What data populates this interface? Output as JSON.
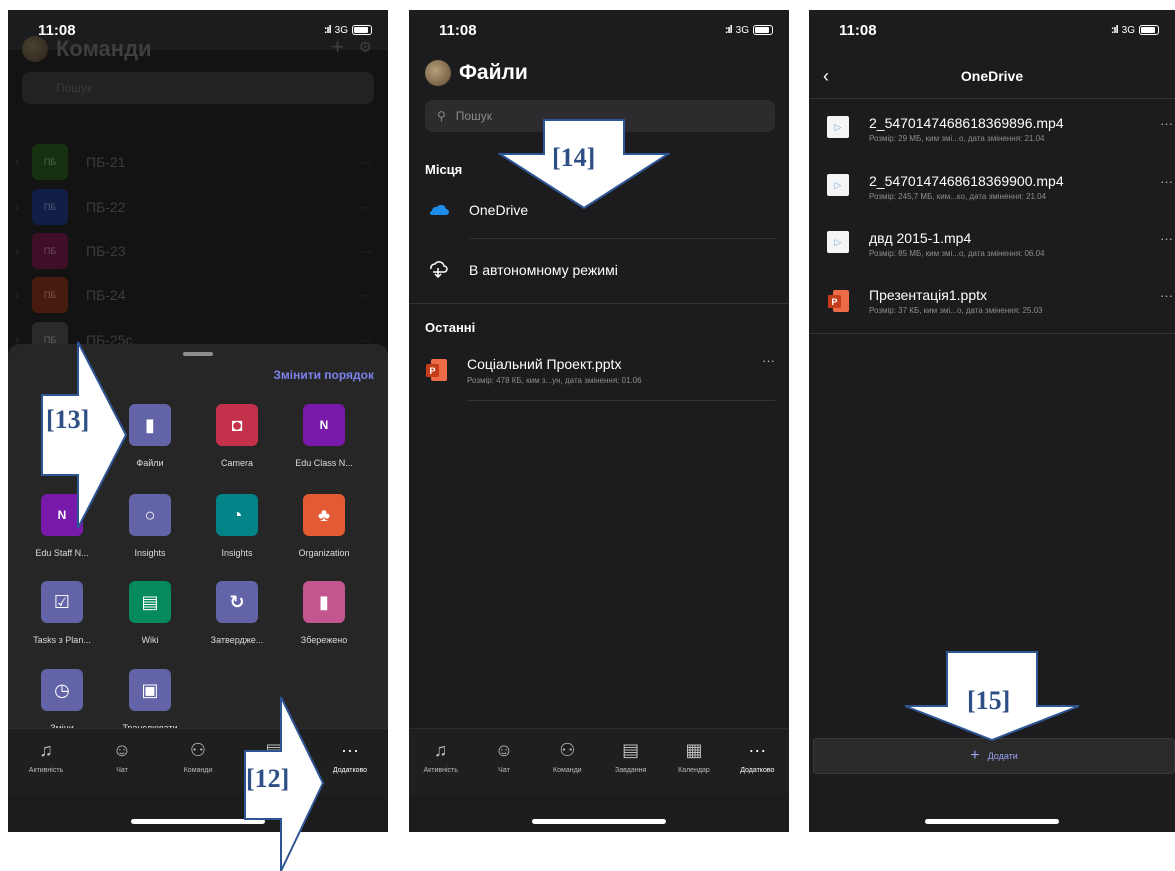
{
  "status": {
    "time": "11:08",
    "network": "3G"
  },
  "tabbar": {
    "items": [
      {
        "label": "Активність",
        "icon": "bell-icon"
      },
      {
        "label": "Чат",
        "icon": "chat-icon"
      },
      {
        "label": "Команди",
        "icon": "teams-icon"
      },
      {
        "label": "Завдання",
        "icon": "clipboard-icon"
      },
      {
        "label": "Календар",
        "icon": "calendar-icon"
      },
      {
        "label": "Додатково",
        "icon": "more-icon"
      }
    ]
  },
  "panel1": {
    "title": "Команди",
    "search_placeholder": "Пошук",
    "teams": [
      {
        "tile": "ПБ",
        "name": "ПБ-21",
        "color": "#2b6b2b"
      },
      {
        "tile": "ПБ",
        "name": "ПБ-22",
        "color": "#2146a5"
      },
      {
        "tile": "ПБ",
        "name": "ПБ-23",
        "color": "#a0205a"
      },
      {
        "tile": "ПБ",
        "name": "ПБ-24",
        "color": "#b8361c"
      },
      {
        "tile": "ПБ",
        "name": "ПБ-25с",
        "color": "#5a5a5a"
      }
    ],
    "sheet": {
      "reorder_label": "Змінити порядок",
      "apps": [
        {
          "label": "Файли",
          "icon": "file-icon",
          "color": "#6264a7"
        },
        {
          "label": "Camera",
          "icon": "camera-icon",
          "color": "#c4314b"
        },
        {
          "label": "Edu Class N...",
          "icon": "onenote-icon",
          "color": "#7719aa"
        },
        {
          "label": "Edu Staff N...",
          "icon": "onenote-icon",
          "color": "#7719aa"
        },
        {
          "label": "Insights",
          "icon": "lightbulb-icon",
          "color": "#6264a7"
        },
        {
          "label": "Insights",
          "icon": "insights-icon",
          "color": "#038387"
        },
        {
          "label": "Organization",
          "icon": "org-chart-icon",
          "color": "#e35b34"
        },
        {
          "label": "Tasks з Plan...",
          "icon": "tasks-icon",
          "color": "#6264a7"
        },
        {
          "label": "Wiki",
          "icon": "wiki-icon",
          "color": "#058a5e"
        },
        {
          "label": "Затвердже...",
          "icon": "approvals-icon",
          "color": "#6264a7"
        },
        {
          "label": "Збережено",
          "icon": "bookmark-icon",
          "color": "#c2578f"
        },
        {
          "label": "Зміни",
          "icon": "shifts-icon",
          "color": "#6264a7"
        },
        {
          "label": "Транслювати",
          "icon": "cast-icon",
          "color": "#6264a7"
        }
      ]
    },
    "tabbar_labels": [
      "Активність",
      "Чат",
      "Команди",
      "Завдання",
      "Додатково"
    ]
  },
  "panel2": {
    "title": "Файли",
    "search_placeholder": "Пошук",
    "places_header": "Місця",
    "places": [
      {
        "label": "OneDrive",
        "icon": "onedrive-cloud-icon"
      },
      {
        "label": "В автономному режимі",
        "icon": "offline-cloud-icon"
      }
    ],
    "recent_header": "Останні",
    "recent": [
      {
        "name": "Соціальний Проект.pptx",
        "meta": "Розмір: 478 КБ, ким з...ун, дата змінення: 01.06"
      }
    ]
  },
  "panel3": {
    "title": "OneDrive",
    "files": [
      {
        "name": "2_5470147468618369896.mp4",
        "meta": "Розмір: 29 МБ, ким змі...о, дата змінення: 21.04",
        "kind": "video"
      },
      {
        "name": "2_5470147468618369900.mp4",
        "meta": "Розмір: 245,7 МБ, ким...ко, дата змінення: 21.04",
        "kind": "video"
      },
      {
        "name": "двд 2015-1.mp4",
        "meta": "Розмір: 85 МБ, ким змі...о, дата змінення: 06.04",
        "kind": "video"
      },
      {
        "name": "Презентація1.pptx",
        "meta": "Розмір: 37 КБ, ким змі...о, дата змінення: 25.03",
        "kind": "pptx"
      }
    ],
    "add_label": "Додати"
  },
  "callouts": {
    "c12": "[12]",
    "c13": "[13]",
    "c14": "[14]",
    "c15": "[15]"
  },
  "colors": {
    "accent": "#7b83eb",
    "callout_fill": "#ffffff",
    "callout_stroke": "#2e5594",
    "callout_text": "#2e4e86"
  }
}
